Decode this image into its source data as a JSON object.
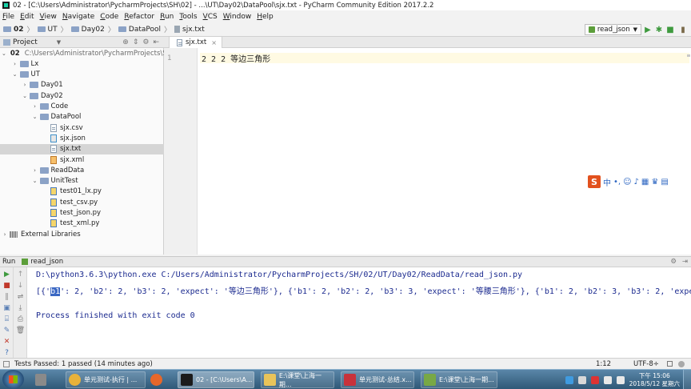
{
  "window": {
    "title": "02 - [C:\\Users\\Administrator\\PycharmProjects\\SH\\02] - ...\\UT\\Day02\\DataPool\\sjx.txt - PyCharm Community Edition 2017.2.2"
  },
  "menu": [
    "File",
    "Edit",
    "View",
    "Navigate",
    "Code",
    "Refactor",
    "Run",
    "Tools",
    "VCS",
    "Window",
    "Help"
  ],
  "breadcrumbs": [
    "02",
    "UT",
    "Day02",
    "DataPool",
    "sjx.txt"
  ],
  "toolbar": {
    "run_config": "read_json"
  },
  "project_panel": {
    "header": "Project",
    "tree": [
      {
        "label": "02",
        "note": "C:\\Users\\Administrator\\PycharmProjects\\SH\\0",
        "type": "module",
        "depth": 0,
        "open": true
      },
      {
        "label": "Lx",
        "type": "folder",
        "depth": 1,
        "open": false
      },
      {
        "label": "UT",
        "type": "folder",
        "depth": 1,
        "open": true
      },
      {
        "label": "Day01",
        "type": "folder",
        "depth": 2,
        "open": false
      },
      {
        "label": "Day02",
        "type": "folder",
        "depth": 2,
        "open": true
      },
      {
        "label": "Code",
        "type": "folder",
        "depth": 3,
        "open": false
      },
      {
        "label": "DataPool",
        "type": "folder",
        "depth": 3,
        "open": true
      },
      {
        "label": "sjx.csv",
        "type": "txt",
        "depth": 4
      },
      {
        "label": "sjx.json",
        "type": "json",
        "depth": 4
      },
      {
        "label": "sjx.txt",
        "type": "txt",
        "depth": 4,
        "selected": true
      },
      {
        "label": "sjx.xml",
        "type": "xml",
        "depth": 4
      },
      {
        "label": "ReadData",
        "type": "folder",
        "depth": 3,
        "open": false
      },
      {
        "label": "UnitTest",
        "type": "folder",
        "depth": 3,
        "open": true
      },
      {
        "label": "test01_lx.py",
        "type": "py",
        "depth": 4
      },
      {
        "label": "test_csv.py",
        "type": "py",
        "depth": 4
      },
      {
        "label": "test_json.py",
        "type": "py",
        "depth": 4
      },
      {
        "label": "test_xml.py",
        "type": "py",
        "depth": 4
      },
      {
        "label": "External Libraries",
        "type": "lib",
        "depth": 0,
        "open": false
      }
    ]
  },
  "editor": {
    "tab": "sjx.txt",
    "line_number": "1",
    "line_text": "2 2 2 等边三角形"
  },
  "run_panel": {
    "label": "Run",
    "config": "read_json",
    "command": "D:\\python3.6.3\\python.exe C:/Users/Administrator/PycharmProjects/SH/02/UT/Day02/ReadData/read_json.py",
    "output_prefix": "[{'",
    "output_selected": "b1",
    "output_rest": "': 2, 'b2': 2, 'b3': 2, 'expect': '等边三角形'}, {'b1': 2, 'b2': 2, 'b3': 3, 'expect': '等腰三角形'}, {'b1': 2, 'b2': 3, 'b3': 2, 'expect':",
    "finish": "Process finished with exit code 0"
  },
  "status_bar": {
    "message": "Tests Passed: 1 passed (14 minutes ago)",
    "position": "1:12",
    "encoding": "UTF-8÷"
  },
  "taskbar": {
    "items": [
      {
        "label": "单元测试-执行 | ...",
        "color": "#e8b23a"
      },
      {
        "label": "",
        "color": "#e6672a"
      },
      {
        "label": "02 - [C:\\Users\\A...",
        "color": "#1b1b1b"
      },
      {
        "label": "E:\\课堂\\上海一期...",
        "color": "#e9c45a"
      },
      {
        "label": "单元测试-总结.x...",
        "color": "#c8323b"
      },
      {
        "label": "E:\\课堂\\上海一期...",
        "color": "#78a845"
      }
    ],
    "clock_time": "下午 15:06",
    "clock_date": "2018/5/12 星期六"
  },
  "ime": {
    "logo": "S",
    "lang": "中"
  }
}
